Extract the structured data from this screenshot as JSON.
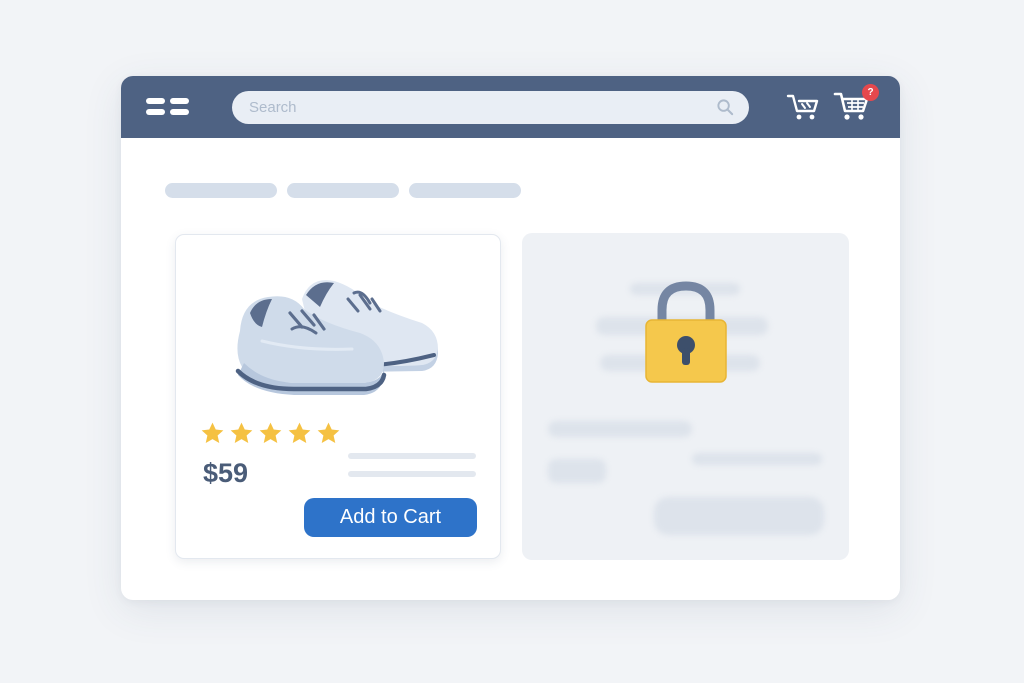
{
  "topbar": {
    "menu_icon": "menu-icon",
    "search": {
      "placeholder": "Search",
      "value": "",
      "icon": "search-icon"
    },
    "cart_plain_icon": "cart-icon",
    "cart_icon": "cart-icon",
    "cart_badge": "?"
  },
  "breadcrumb": {
    "items": 3
  },
  "product": {
    "image_icon": "sneakers-image",
    "rating": 5,
    "rating_max": 5,
    "price": "$59",
    "add_to_cart_label": "Add to Cart"
  },
  "locked_item": {
    "icon": "lock-icon",
    "state": "locked"
  },
  "colors": {
    "topbar": "#4e6283",
    "accent": "#2e73c9",
    "star": "#f5c142",
    "lock": "#f5c84c",
    "badge": "#e5484d",
    "background": "#f2f4f7"
  }
}
